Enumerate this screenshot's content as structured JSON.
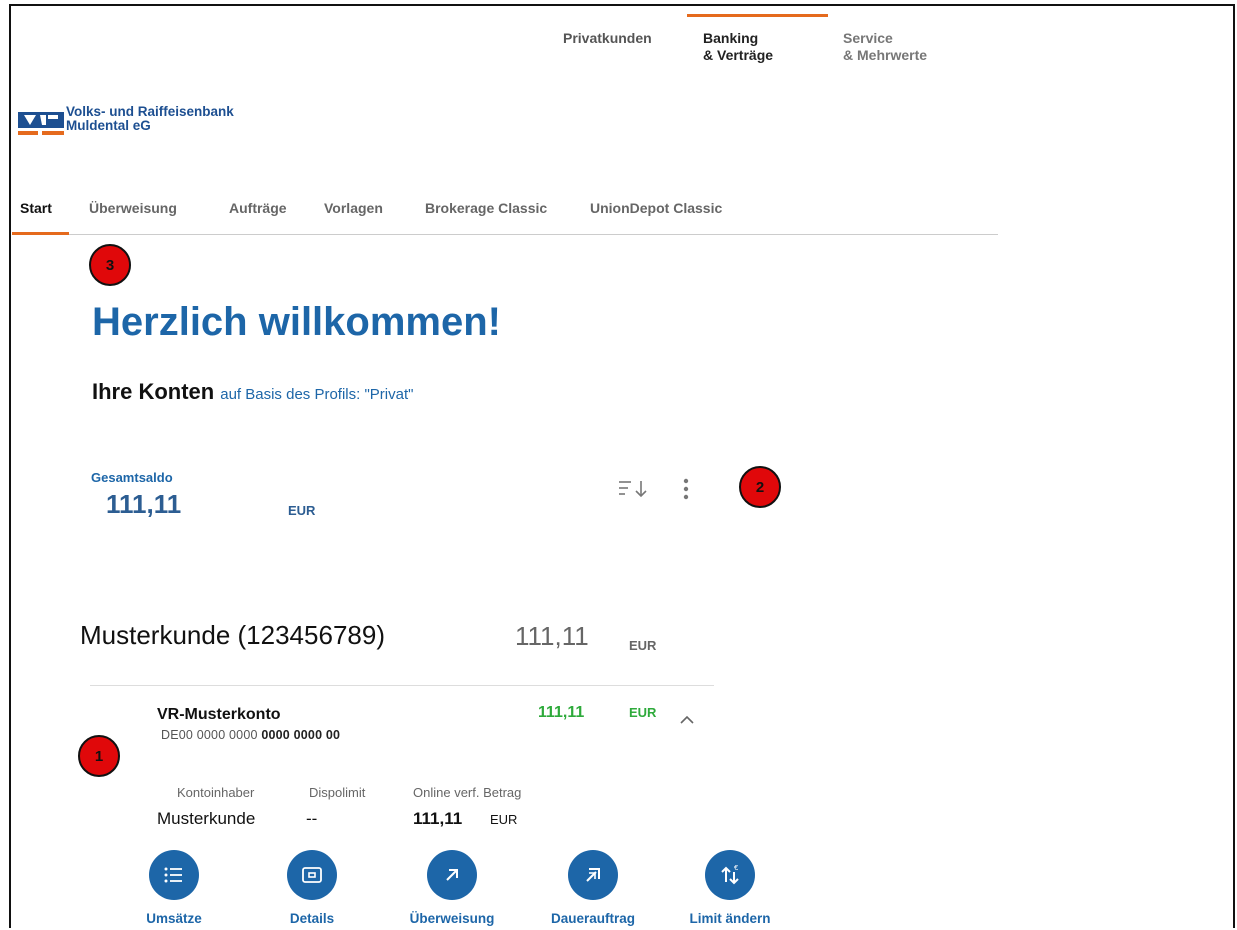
{
  "top_nav": {
    "items": [
      {
        "label": "Privatkunden"
      },
      {
        "label_line1": "Banking",
        "label_line2": "& Verträge"
      },
      {
        "label_line1": "Service",
        "label_line2": "& Mehrwerte"
      }
    ]
  },
  "logo": {
    "line1": "Volks- und Raiffeisenbank",
    "line2": "Muldental eG"
  },
  "sub_nav": {
    "items": [
      "Start",
      "Überweisung",
      "Aufträge",
      "Vorlagen",
      "Brokerage Classic",
      "UnionDepot Classic"
    ]
  },
  "badges": {
    "b1": "1",
    "b2": "2",
    "b3": "3"
  },
  "welcome": {
    "title": "Herzlich willkommen!"
  },
  "konten": {
    "heading": "Ihre Konten",
    "profile_text": "auf Basis des Profils: \"Privat\""
  },
  "gesamtsaldo": {
    "label": "Gesamtsaldo",
    "value": "111,11",
    "currency": "EUR"
  },
  "customer": {
    "name": "Musterkunde (123456789)",
    "balance": "111,11",
    "currency": "EUR"
  },
  "account": {
    "name": "VR-Musterkonto",
    "iban_prefix": "DE00 0000 0000",
    "iban_suffix": "0000 0000 00",
    "balance": "111,11",
    "currency": "EUR",
    "details": {
      "holder_label": "Kontoinhaber",
      "holder_value": "Musterkunde",
      "limit_label": "Dispolimit",
      "limit_value": "--",
      "available_label": "Online verf. Betrag",
      "available_value": "111,11",
      "available_currency": "EUR"
    }
  },
  "actions": [
    "Umsätze",
    "Details",
    "Überweisung",
    "Dauerauftrag",
    "Limit ändern"
  ],
  "colors": {
    "primary": "#1d66a8",
    "accent": "#e56a1d",
    "positive": "#2eaa3b",
    "badge": "#e0080a"
  }
}
